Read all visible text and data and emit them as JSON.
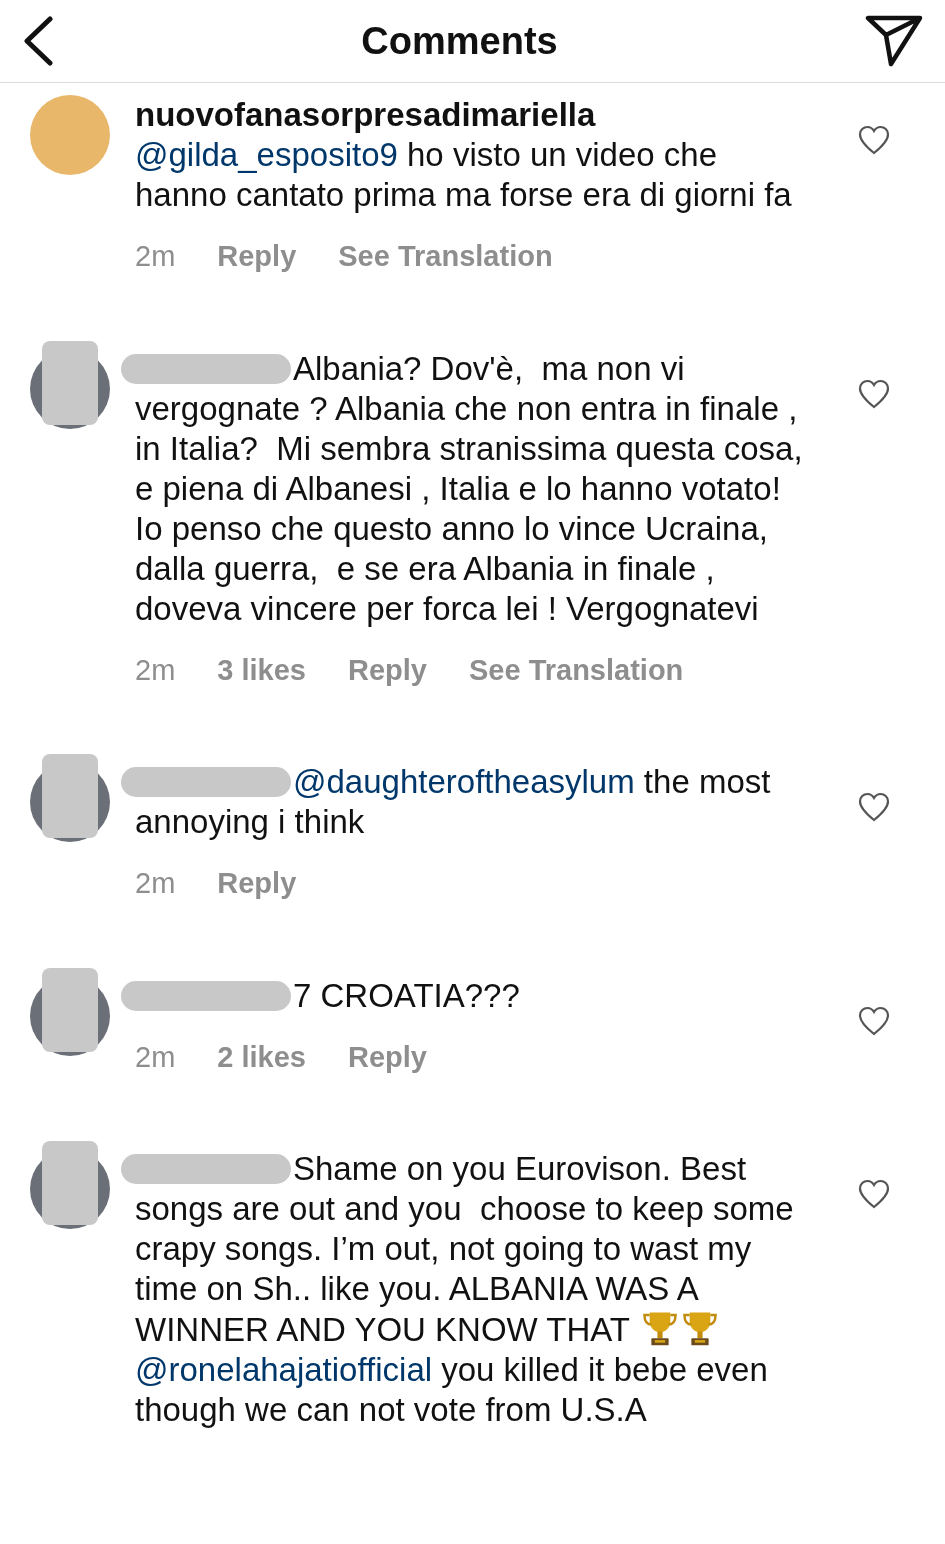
{
  "header": {
    "title": "Comments"
  },
  "comments": [
    {
      "username": "nuovofanasorpresadimariella",
      "redacted": false,
      "avatar_redacted": false,
      "parts": [
        {
          "kind": "mention",
          "text": "@gilda_esposito9"
        },
        {
          "kind": "text",
          "text": " ho visto un video che hanno cantato prima ma forse era di giorni fa"
        }
      ],
      "meta": [
        {
          "kind": "time",
          "text": "2m"
        },
        {
          "kind": "reply",
          "text": "Reply"
        },
        {
          "kind": "translate",
          "text": "See Translation"
        }
      ]
    },
    {
      "redacted": true,
      "avatar_redacted": true,
      "parts": [
        {
          "kind": "text",
          "text": "Albania? Dov'è,  ma non vi vergognate ? Albania che non entra in finale , in Italia?  Mi sembra stranissima questa cosa, e piena di Albanesi , Italia e lo hanno votato! Io penso che questo anno lo vince Ucraina,  dalla guerra,  e se era Albania in finale , doveva vincere per forca lei ! Vergognatevi"
        }
      ],
      "meta": [
        {
          "kind": "time",
          "text": "2m"
        },
        {
          "kind": "likes",
          "text": "3 likes"
        },
        {
          "kind": "reply",
          "text": "Reply"
        },
        {
          "kind": "translate",
          "text": "See Translation"
        }
      ]
    },
    {
      "redacted": true,
      "avatar_redacted": true,
      "parts": [
        {
          "kind": "mention",
          "text": "@daughteroftheasylum"
        },
        {
          "kind": "text",
          "text": " the most annoying i think"
        }
      ],
      "meta": [
        {
          "kind": "time",
          "text": "2m"
        },
        {
          "kind": "reply",
          "text": "Reply"
        }
      ]
    },
    {
      "redacted": true,
      "avatar_redacted": true,
      "parts": [
        {
          "kind": "text",
          "text": "7 CROATIA???"
        }
      ],
      "meta": [
        {
          "kind": "time",
          "text": "2m"
        },
        {
          "kind": "likes",
          "text": "2 likes"
        },
        {
          "kind": "reply",
          "text": "Reply"
        }
      ]
    },
    {
      "redacted": true,
      "avatar_redacted": true,
      "parts": [
        {
          "kind": "text",
          "text": "Shame on you Eurovison. Best songs are out and you  choose to keep some crapy songs. I’m out, not going to wast my time on Sh.. like you. ALBANIA WAS A WINNER AND YOU KNOW THAT "
        },
        {
          "kind": "trophy"
        },
        {
          "kind": "trophy"
        },
        {
          "kind": "break"
        },
        {
          "kind": "mention",
          "text": "@ronelahajatiofficial"
        },
        {
          "kind": "text",
          "text": " you killed it bebe even though we can not vote from U.S.A"
        }
      ]
    }
  ]
}
